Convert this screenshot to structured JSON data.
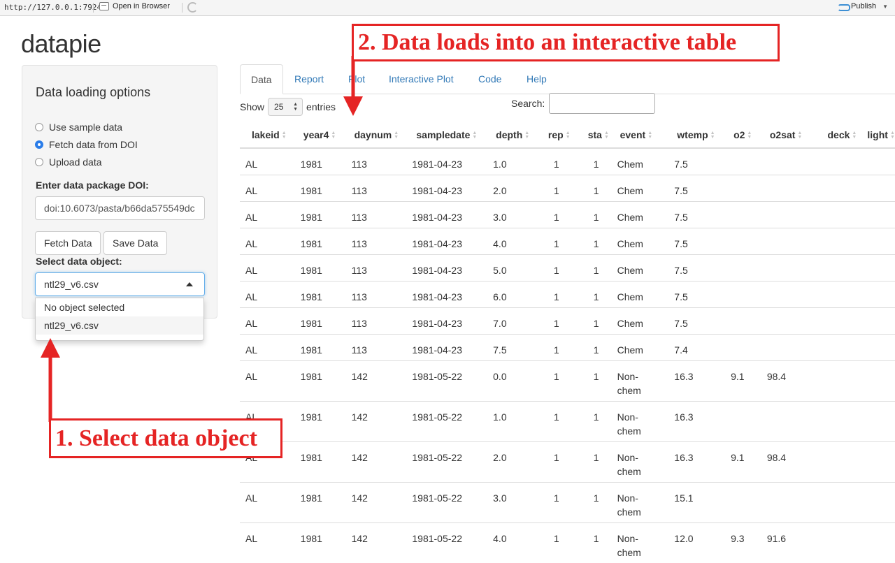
{
  "browser_bar": {
    "url": "http://127.0.0.1:7924",
    "open_in_browser": "Open in Browser",
    "publish": "Publish"
  },
  "app": {
    "title": "datapie"
  },
  "sidebar": {
    "title": "Data loading options",
    "radio_options": [
      "Use sample data",
      "Fetch data from DOI",
      "Upload data"
    ],
    "selected_radio": "Fetch data from DOI",
    "doi_label": "Enter data package DOI:",
    "doi_value": "doi:10.6073/pasta/b66da575549dc",
    "fetch_button": "Fetch Data",
    "save_button": "Save Data",
    "select_label": "Select data object:",
    "select_value": "ntl29_v6.csv",
    "dropdown_options": [
      "No object selected",
      "ntl29_v6.csv"
    ]
  },
  "tabs": [
    "Data",
    "Report",
    "Plot",
    "Interactive Plot",
    "Code",
    "Help"
  ],
  "active_tab": "Data",
  "table_controls": {
    "show_label": "Show",
    "entries_value": "25",
    "entries_label": "entries",
    "search_label": "Search:",
    "search_value": ""
  },
  "table": {
    "columns": [
      "lakeid",
      "year4",
      "daynum",
      "sampledate",
      "depth",
      "rep",
      "sta",
      "event",
      "wtemp",
      "o2",
      "o2sat",
      "deck",
      "light"
    ],
    "rows": [
      [
        "AL",
        "1981",
        "113",
        "1981-04-23",
        "1.0",
        "1",
        "1",
        "Chem",
        "7.5",
        "",
        "",
        "",
        ""
      ],
      [
        "AL",
        "1981",
        "113",
        "1981-04-23",
        "2.0",
        "1",
        "1",
        "Chem",
        "7.5",
        "",
        "",
        "",
        ""
      ],
      [
        "AL",
        "1981",
        "113",
        "1981-04-23",
        "3.0",
        "1",
        "1",
        "Chem",
        "7.5",
        "",
        "",
        "",
        ""
      ],
      [
        "AL",
        "1981",
        "113",
        "1981-04-23",
        "4.0",
        "1",
        "1",
        "Chem",
        "7.5",
        "",
        "",
        "",
        ""
      ],
      [
        "AL",
        "1981",
        "113",
        "1981-04-23",
        "5.0",
        "1",
        "1",
        "Chem",
        "7.5",
        "",
        "",
        "",
        ""
      ],
      [
        "AL",
        "1981",
        "113",
        "1981-04-23",
        "6.0",
        "1",
        "1",
        "Chem",
        "7.5",
        "",
        "",
        "",
        ""
      ],
      [
        "AL",
        "1981",
        "113",
        "1981-04-23",
        "7.0",
        "1",
        "1",
        "Chem",
        "7.5",
        "",
        "",
        "",
        ""
      ],
      [
        "AL",
        "1981",
        "113",
        "1981-04-23",
        "7.5",
        "1",
        "1",
        "Chem",
        "7.4",
        "",
        "",
        "",
        ""
      ],
      [
        "AL",
        "1981",
        "142",
        "1981-05-22",
        "0.0",
        "1",
        "1",
        "Non-chem",
        "16.3",
        "9.1",
        "98.4",
        "",
        ""
      ],
      [
        "AL",
        "1981",
        "142",
        "1981-05-22",
        "1.0",
        "1",
        "1",
        "Non-chem",
        "16.3",
        "",
        "",
        "",
        ""
      ],
      [
        "AL",
        "1981",
        "142",
        "1981-05-22",
        "2.0",
        "1",
        "1",
        "Non-chem",
        "16.3",
        "9.1",
        "98.4",
        "",
        ""
      ],
      [
        "AL",
        "1981",
        "142",
        "1981-05-22",
        "3.0",
        "1",
        "1",
        "Non-chem",
        "15.1",
        "",
        "",
        "",
        ""
      ],
      [
        "AL",
        "1981",
        "142",
        "1981-05-22",
        "4.0",
        "1",
        "1",
        "Non-chem",
        "12.0",
        "9.3",
        "91.6",
        "",
        ""
      ]
    ]
  },
  "annotations": {
    "step1": "1. Select data object",
    "step2": "2. Data loads into an interactive table",
    "color": "#e52424"
  }
}
